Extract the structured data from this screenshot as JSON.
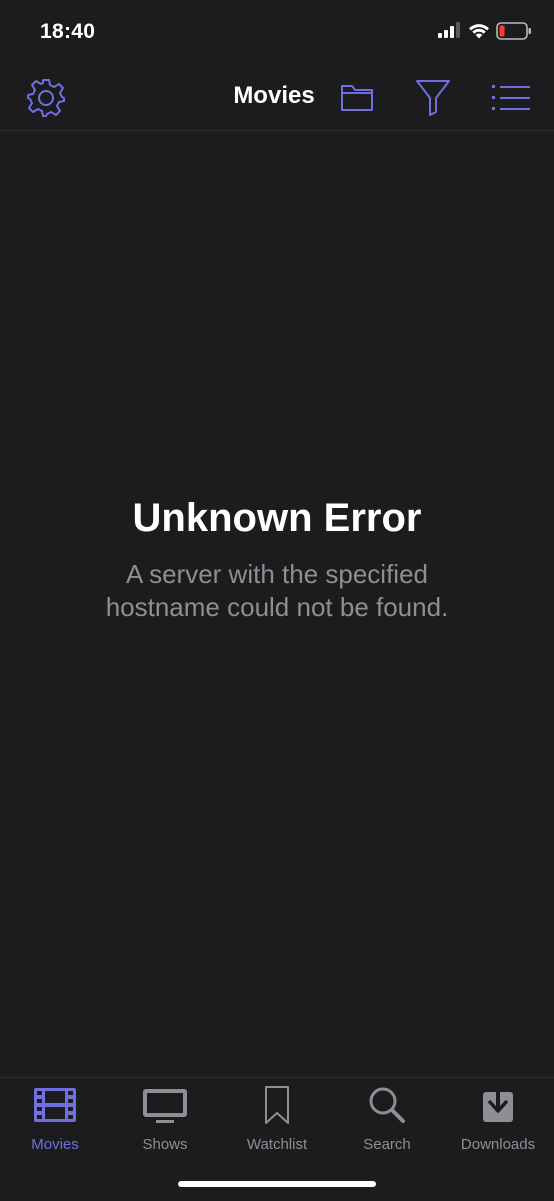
{
  "status_bar": {
    "time": "18:40"
  },
  "nav_bar": {
    "title": "Movies",
    "icons": [
      "gear-icon",
      "folder-icon",
      "filter-icon",
      "list-icon"
    ]
  },
  "error": {
    "title": "Unknown Error",
    "message": "A server with the specified hostname could not be found."
  },
  "tab_bar": {
    "tabs": [
      {
        "label": "Movies",
        "icon": "film-icon",
        "active": true
      },
      {
        "label": "Shows",
        "icon": "tv-icon",
        "active": false
      },
      {
        "label": "Watchlist",
        "icon": "bookmark-icon",
        "active": false
      },
      {
        "label": "Search",
        "icon": "search-icon",
        "active": false
      },
      {
        "label": "Downloads",
        "icon": "download-icon",
        "active": false
      }
    ]
  },
  "colors": {
    "background": "#1c1c1e",
    "accent": "#6f6fe0",
    "inactive": "#8e8e93",
    "battery_low": "#ff3b30"
  }
}
